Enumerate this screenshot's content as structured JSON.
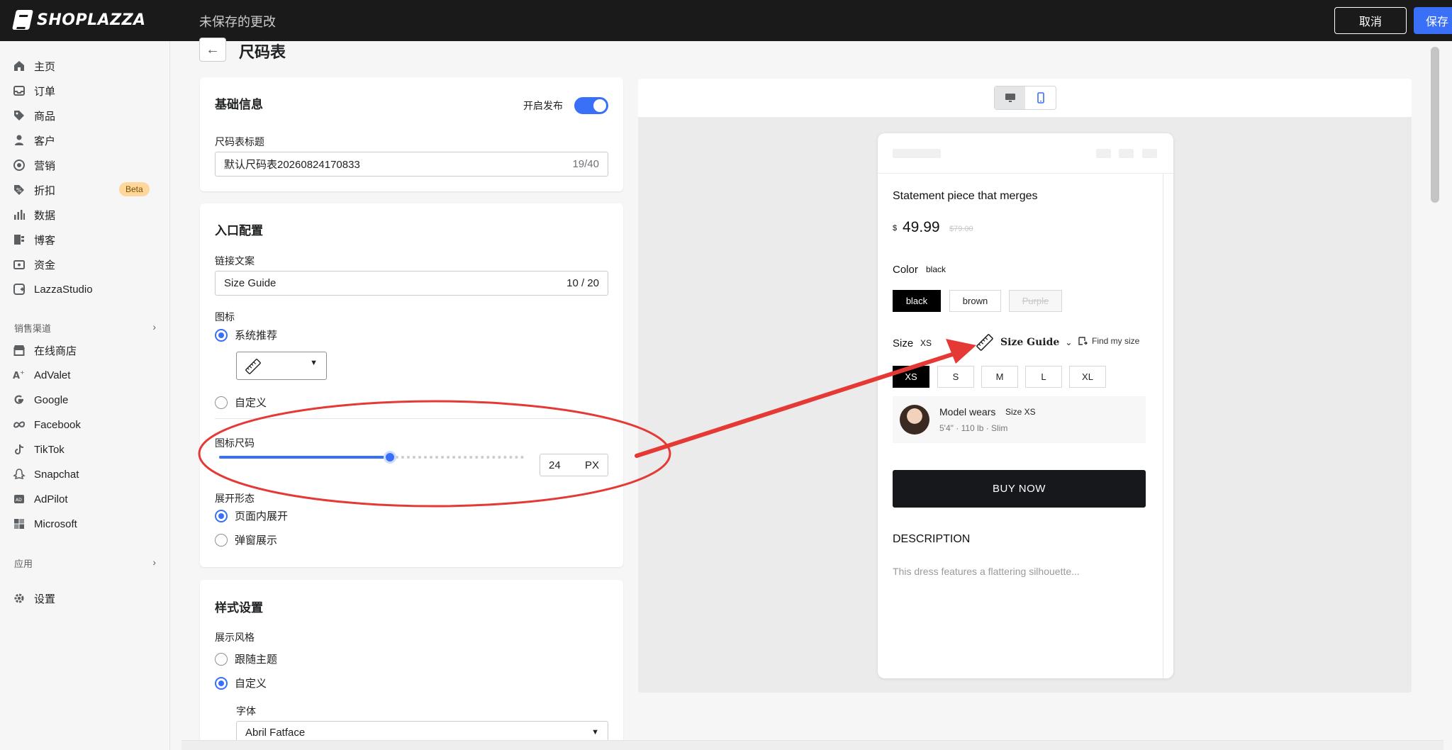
{
  "topbar": {
    "logo": "SHOPLAZZA",
    "status": "未保存的更改",
    "cancel": "取消",
    "save": "保存"
  },
  "sidebar": {
    "items": [
      {
        "label": "主页",
        "icon": "home-icon"
      },
      {
        "label": "订单",
        "icon": "inbox-icon"
      },
      {
        "label": "商品",
        "icon": "tag-icon"
      },
      {
        "label": "客户",
        "icon": "person-icon"
      },
      {
        "label": "营销",
        "icon": "target-icon"
      },
      {
        "label": "折扣",
        "icon": "discount-icon",
        "badge": "Beta"
      },
      {
        "label": "数据",
        "icon": "bar-chart-icon"
      },
      {
        "label": "博客",
        "icon": "blog-icon"
      },
      {
        "label": "资金",
        "icon": "wallet-icon"
      },
      {
        "label": "LazzaStudio",
        "icon": "studio-icon"
      }
    ],
    "sales_channel_title": "销售渠道",
    "channels": [
      {
        "label": "在线商店",
        "icon": "store-icon"
      },
      {
        "label": "AdValet",
        "icon": "advalet-icon"
      },
      {
        "label": "Google",
        "icon": "google-icon"
      },
      {
        "label": "Facebook",
        "icon": "meta-icon"
      },
      {
        "label": "TikTok",
        "icon": "tiktok-icon"
      },
      {
        "label": "Snapchat",
        "icon": "snapchat-icon"
      },
      {
        "label": "AdPilot",
        "icon": "adpilot-icon"
      },
      {
        "label": "Microsoft",
        "icon": "microsoft-icon"
      }
    ],
    "apps_title": "应用",
    "settings": "设置"
  },
  "page": {
    "title": "尺码表"
  },
  "basic_info": {
    "title": "基础信息",
    "publish_label": "开启发布",
    "publish_on": true,
    "chart_title_label": "尺码表标题",
    "chart_title_value": "默认尺码表20260824170833",
    "chart_title_count": "19/40"
  },
  "entry_config": {
    "title": "入口配置",
    "link_text_label": "链接文案",
    "link_text_value": "Size Guide",
    "link_text_count": "10 / 20",
    "icon_label": "图标",
    "icon_option_recommended": "系统推荐",
    "icon_option_custom": "自定义",
    "icon_size_label": "图标尺码",
    "icon_size_value": "24",
    "icon_size_unit": "PX",
    "icon_size_fraction": 0.56,
    "expand_label": "展开形态",
    "expand_inline": "页面内展开",
    "expand_popup": "弹窗展示"
  },
  "style_settings": {
    "title": "样式设置",
    "display_style_label": "展示风格",
    "follow_theme": "跟随主题",
    "custom": "自定义",
    "font_label": "字体",
    "font_value": "Abril Fatface"
  },
  "preview": {
    "product_title": "Statement piece that merges",
    "currency": "$",
    "price": "49.99",
    "compare_price": "$79.00",
    "color_label": "Color",
    "color_value": "black",
    "colors": [
      "black",
      "brown",
      "Purple"
    ],
    "size_label": "Size",
    "size_value": "XS",
    "size_guide": "Size Guide",
    "find_my_size": "Find my size",
    "sizes": [
      "XS",
      "S",
      "M",
      "L",
      "XL"
    ],
    "model_wears": "Model wears",
    "model_size": "Size XS",
    "model_meta": "5'4\" · 110 lb · Slim",
    "buy_now": "BUY NOW",
    "description_title": "DESCRIPTION",
    "description_text": "This dress features a flattering silhouette..."
  },
  "colors": {
    "accent": "#3a6ff7",
    "annotation": "#e53935",
    "topbar": "#1a1a1a"
  }
}
